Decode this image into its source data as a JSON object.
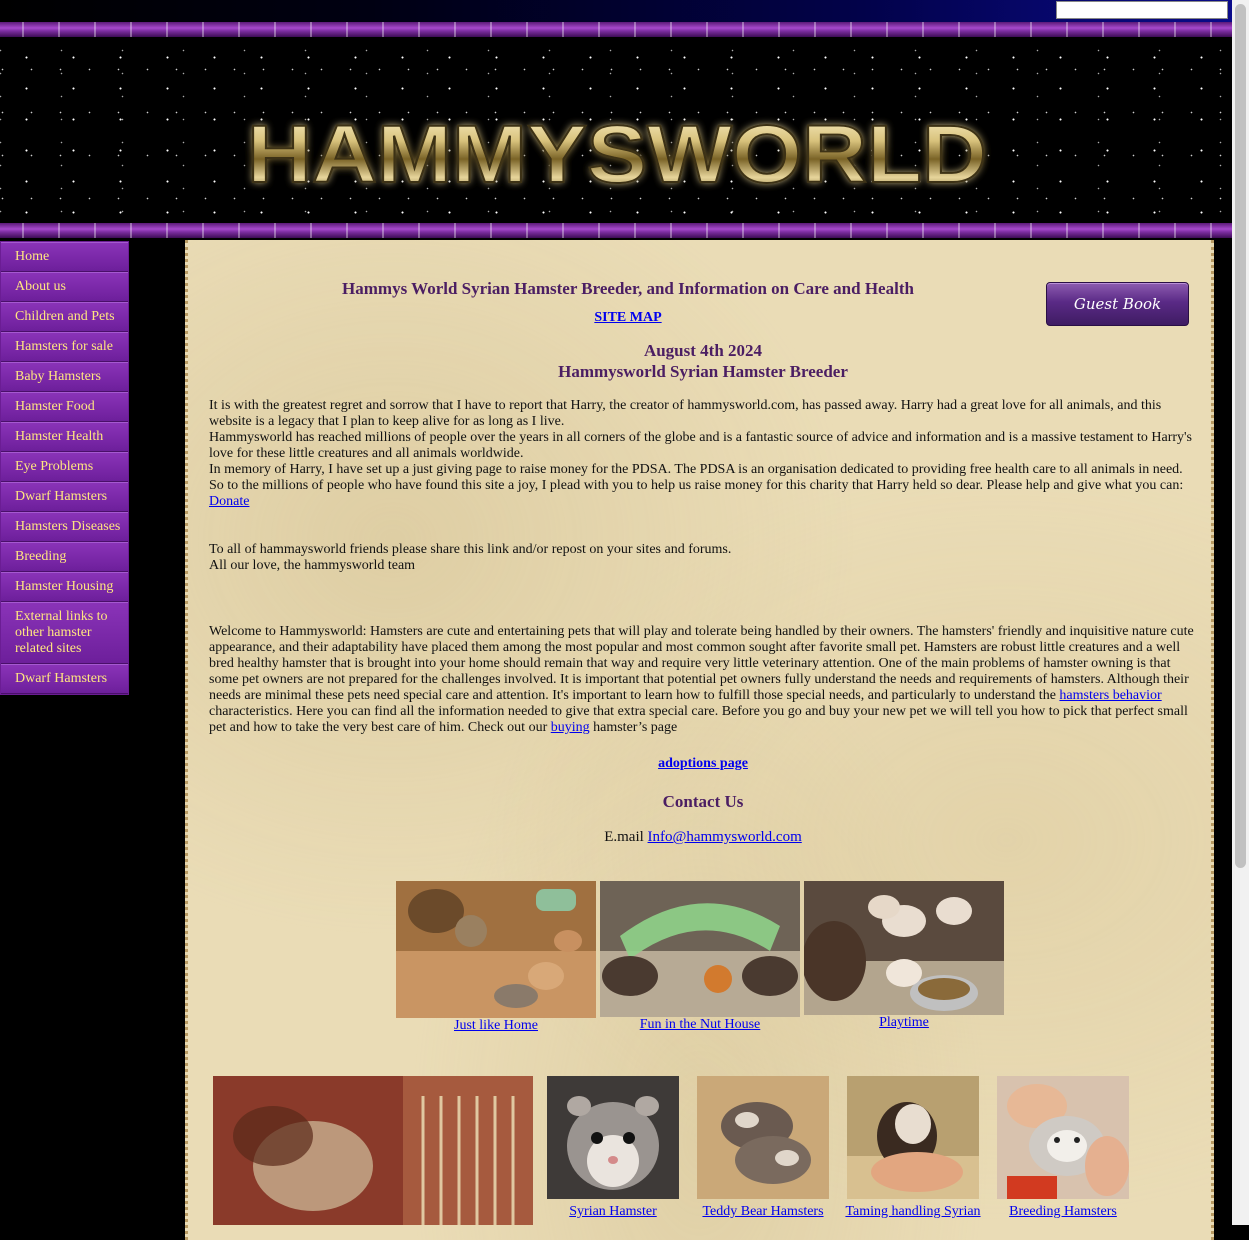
{
  "search": {
    "value": ""
  },
  "banner": {
    "logo_text": "HAMMYSWORLD"
  },
  "sidebar": {
    "items": [
      {
        "label": "Home"
      },
      {
        "label": "About us"
      },
      {
        "label": "Children and Pets"
      },
      {
        "label": "Hamsters for sale"
      },
      {
        "label": "Baby Hamsters"
      },
      {
        "label": "Hamster Food"
      },
      {
        "label": "Hamster Health"
      },
      {
        "label": "Eye Problems"
      },
      {
        "label": "Dwarf Hamsters"
      },
      {
        "label": "Hamsters Diseases"
      },
      {
        "label": "Breeding"
      },
      {
        "label": "Hamster Housing"
      },
      {
        "label": "External links to other hamster related sites"
      },
      {
        "label": "Dwarf Hamsters"
      }
    ]
  },
  "header": {
    "title": "Hammys World Syrian Hamster Breeder, and Information on Care and Health",
    "site_map": "SITE MAP",
    "guest_book": "Guest Book",
    "date": "August 4th 2024",
    "subtitle": "Hammysworld Syrian Hamster Breeder"
  },
  "memorial": {
    "p1": "It is with the greatest regret and sorrow that I have to report that Harry, the creator of hammysworld.com, has passed away. Harry had a great love for all animals, and this website is a legacy that I plan to keep alive for as long as I live.",
    "p2": "Hammysworld has reached millions of people over the years in all corners of the globe and is a fantastic source of advice and information and is a massive testament to Harry's love for these little creatures and all animals worldwide.",
    "p3": "In memory of Harry, I have set up a just giving page to raise money for the PDSA. The PDSA is an organisation dedicated to providing free health care to all animals in need.",
    "p4": "So to the millions of people who have found this site a joy, I plead with you to help us raise money for this charity that Harry held so dear. Please help and give what you can:",
    "donate": "Donate",
    "share": "To all of hammaysworld friends please share this link and/or repost on your sites and forums.",
    "love": "All our love, the hammysworld team"
  },
  "welcome": {
    "text1": "Welcome to Hammysworld: Hamsters are cute and entertaining pets that will play and tolerate being handled by their owners. The hamsters' friendly and inquisitive nature cute appearance, and their adaptability have placed them among the most popular and most common sought after favorite small pet. Hamsters are robust little creatures and a well bred healthy hamster that is brought into your home should remain that way and require very little veterinary attention. One of the main problems of hamster owning is that some pet owners are not prepared for the challenges involved. It is important that potential pet owners fully understand the needs and requirements of hamsters. Although their needs are minimal these pets need special care and attention. It's important to learn how to fulfill those special needs, and particularly to understand the ",
    "behavior_link": "hamsters behavior",
    "text2": " characteristics. Here you can find all the information needed to give that extra special care. Before you go and buy your new pet we will tell you how to pick that perfect small pet and how to take the very best care of him. Check out our ",
    "buying_link": "buying",
    "text3": " hamster’s page"
  },
  "adoptions": "adoptions page",
  "contact": {
    "heading": "Contact Us",
    "email_label": "E.mail ",
    "email": "Info@hammysworld.com"
  },
  "gallery_row1": [
    {
      "caption": "Just like Home"
    },
    {
      "caption": "Fun in the Nut House"
    },
    {
      "caption": "Playtime"
    }
  ],
  "gallery_row2": [
    {
      "caption": "Syrian Hamster"
    },
    {
      "caption": "Teddy Bear Hamsters"
    },
    {
      "caption": "Taming handling Syrian"
    },
    {
      "caption": "Breeding Hamsters"
    }
  ]
}
